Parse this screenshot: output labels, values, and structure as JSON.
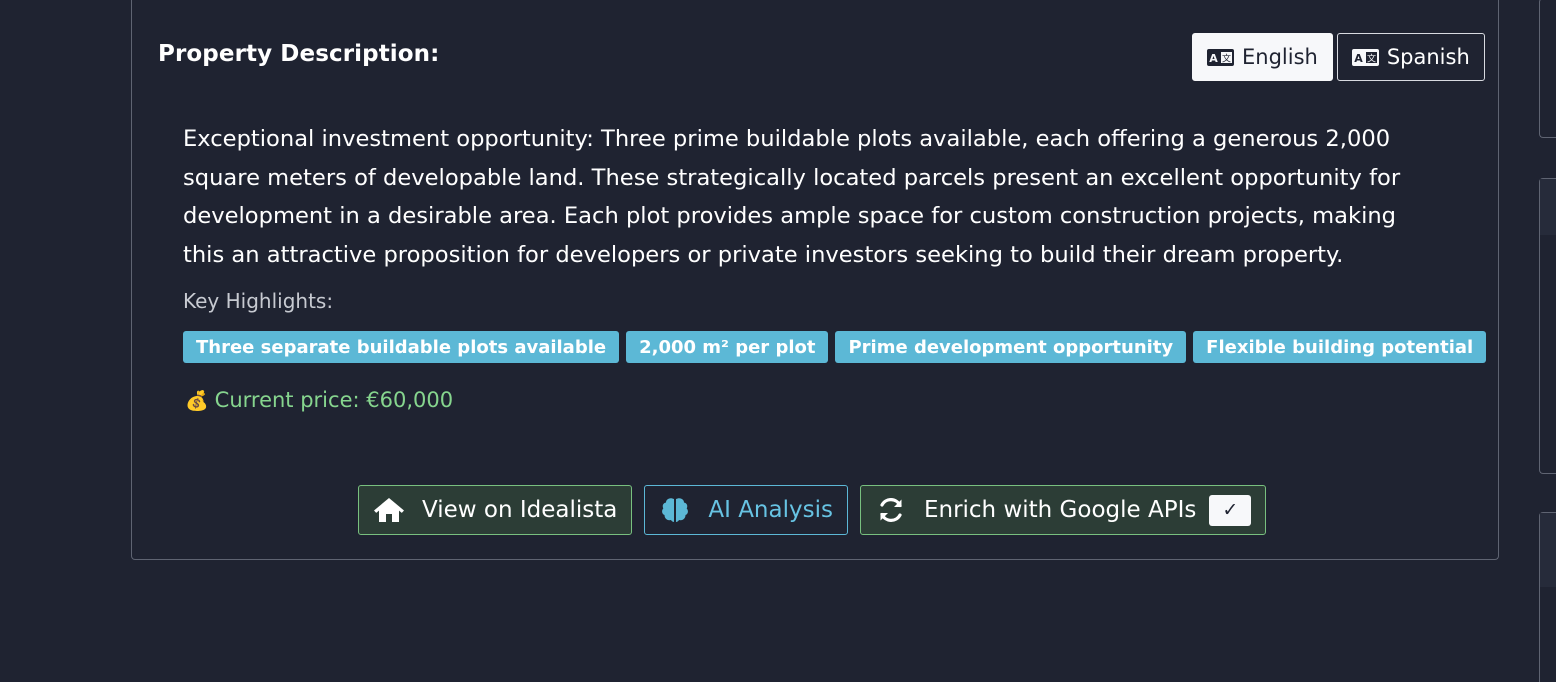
{
  "section": {
    "title": "Property Description:"
  },
  "language_toggle": {
    "options": [
      {
        "label": "English",
        "active": true,
        "icon": "translate-icon"
      },
      {
        "label": "Spanish",
        "active": false,
        "icon": "translate-icon"
      }
    ]
  },
  "description": {
    "text": "Exceptional investment opportunity: Three prime buildable plots available, each offering a generous 2,000 square meters of developable land. These strategically located parcels present an excellent opportunity for development in a desirable area. Each plot provides ample space for custom construction projects, making this an attractive proposition for developers or private investors seeking to build their dream property."
  },
  "highlights": {
    "label": "Key Highlights:",
    "items": [
      "Three separate buildable plots available",
      "2,000 m² per plot",
      "Prime development opportunity",
      "Flexible building potential"
    ]
  },
  "price": {
    "icon": "💰",
    "text": "Current price: €60,000"
  },
  "actions": {
    "view_idealista": "View on Idealista",
    "ai_analysis": "AI Analysis",
    "enrich_google": "Enrich with Google APIs",
    "enrich_status": "✓"
  },
  "colors": {
    "background": "#1f2331",
    "badge": "#5cb8d6",
    "price": "#86d58e",
    "success_border": "#78c07f",
    "info": "#5cb8d6"
  }
}
